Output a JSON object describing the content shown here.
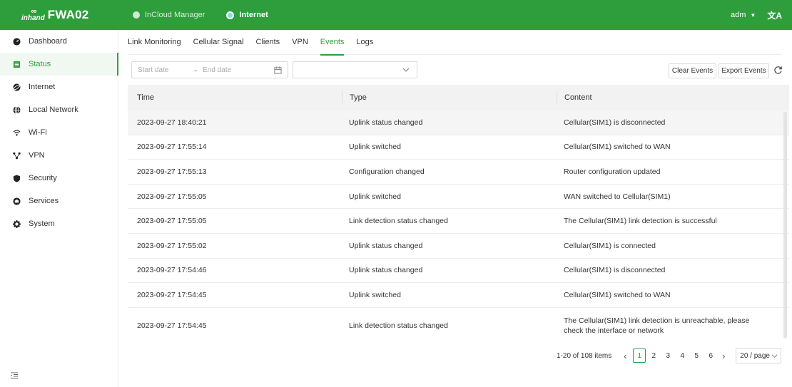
{
  "app": {
    "logo_text": "inhand",
    "product_name": "FWA02",
    "top_tabs": [
      {
        "label": "InCloud Manager"
      },
      {
        "label": "Internet"
      }
    ],
    "user": "adm",
    "lang_icon": "translate-icon"
  },
  "sidebar": {
    "items": [
      {
        "label": "Dashboard",
        "icon": "dashboard-icon"
      },
      {
        "label": "Status",
        "icon": "status-icon"
      },
      {
        "label": "Internet",
        "icon": "internet-icon"
      },
      {
        "label": "Local Network",
        "icon": "globe-icon"
      },
      {
        "label": "Wi-Fi",
        "icon": "wifi-icon"
      },
      {
        "label": "VPN",
        "icon": "vpn-icon"
      },
      {
        "label": "Security",
        "icon": "shield-icon"
      },
      {
        "label": "Services",
        "icon": "services-icon"
      },
      {
        "label": "System",
        "icon": "gear-icon"
      }
    ],
    "active_index": 1
  },
  "subtabs": {
    "items": [
      "Link Monitoring",
      "Cellular Signal",
      "Clients",
      "VPN",
      "Events",
      "Logs"
    ],
    "active_index": 4
  },
  "toolbar": {
    "start_placeholder": "Start date",
    "end_placeholder": "End date",
    "type_value": "",
    "clear_label": "Clear Events",
    "export_label": "Export Events"
  },
  "table": {
    "headers": {
      "time": "Time",
      "type": "Type",
      "content": "Content"
    },
    "rows": [
      {
        "time": "2023-09-27 18:40:21",
        "type": "Uplink status changed",
        "content": "Cellular(SIM1) is disconnected"
      },
      {
        "time": "2023-09-27 17:55:14",
        "type": "Uplink switched",
        "content": "Cellular(SIM1) switched to WAN"
      },
      {
        "time": "2023-09-27 17:55:13",
        "type": "Configuration changed",
        "content": "Router configuration updated"
      },
      {
        "time": "2023-09-27 17:55:05",
        "type": "Uplink switched",
        "content": "WAN switched to Cellular(SIM1)"
      },
      {
        "time": "2023-09-27 17:55:05",
        "type": "Link detection status changed",
        "content": "The Cellular(SIM1) link detection is successful"
      },
      {
        "time": "2023-09-27 17:55:02",
        "type": "Uplink status changed",
        "content": "Cellular(SIM1) is connected"
      },
      {
        "time": "2023-09-27 17:54:46",
        "type": "Uplink status changed",
        "content": "Cellular(SIM1) is disconnected"
      },
      {
        "time": "2023-09-27 17:54:45",
        "type": "Uplink switched",
        "content": "Cellular(SIM1) switched to WAN"
      },
      {
        "time": "2023-09-27 17:54:45",
        "type": "Link detection status changed",
        "content": "The Cellular(SIM1) link detection is unreachable, please check the interface or network"
      }
    ]
  },
  "pagination": {
    "summary": "1-20 of 108 items",
    "pages": [
      "1",
      "2",
      "3",
      "4",
      "5",
      "6"
    ],
    "active_page": "1",
    "page_size": "20 / page"
  },
  "colors": {
    "brand": "#2e9e3c",
    "header_bg": "#f2f2f2"
  }
}
